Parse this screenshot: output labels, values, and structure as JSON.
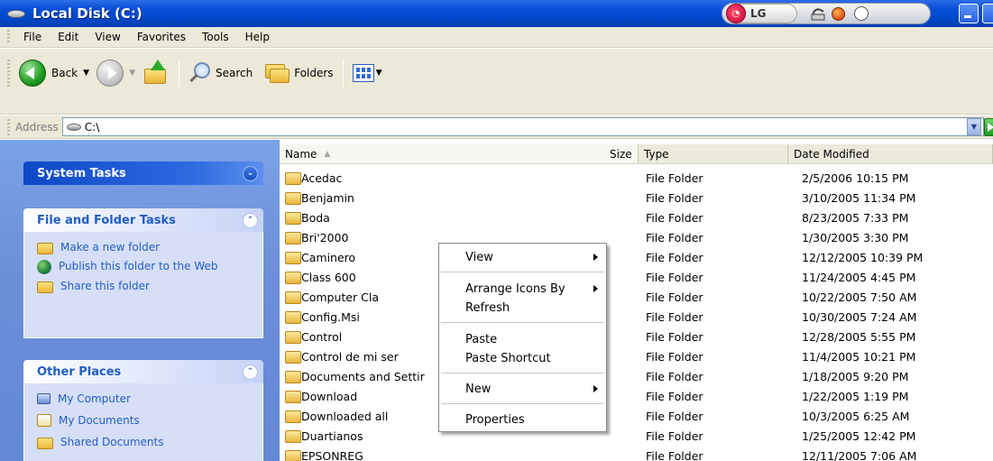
{
  "window": {
    "title": "Local Disk (C:)"
  },
  "tray": {
    "brand": "LG"
  },
  "menubar": {
    "items": [
      "File",
      "Edit",
      "View",
      "Favorites",
      "Tools",
      "Help"
    ]
  },
  "toolbar": {
    "back_label": "Back",
    "search_label": "Search",
    "folders_label": "Folders"
  },
  "address": {
    "label": "Address",
    "value": "C:\\"
  },
  "sidebar": {
    "system_tasks": {
      "title": "System Tasks"
    },
    "file_folder_tasks": {
      "title": "File and Folder Tasks",
      "items": [
        "Make a new folder",
        "Publish this folder to the Web",
        "Share this folder"
      ]
    },
    "other_places": {
      "title": "Other Places",
      "items": [
        "My Computer",
        "My Documents",
        "Shared Documents"
      ]
    }
  },
  "list": {
    "columns": {
      "name": "Name",
      "size": "Size",
      "type": "Type",
      "date": "Date Modified"
    },
    "rows": [
      {
        "name": "Acedac",
        "type": "File Folder",
        "date": "2/5/2006 10:15 PM"
      },
      {
        "name": "Benjamin",
        "type": "File Folder",
        "date": "3/10/2005 11:34 PM"
      },
      {
        "name": "Boda",
        "type": "File Folder",
        "date": "8/23/2005 7:33 PM"
      },
      {
        "name": "Bri'2000",
        "type": "File Folder",
        "date": "1/30/2005 3:30 PM"
      },
      {
        "name": "Caminero",
        "type": "File Folder",
        "date": "12/12/2005 10:39 PM"
      },
      {
        "name": "Class 600",
        "type": "File Folder",
        "date": "11/24/2005 4:45 PM"
      },
      {
        "name": "Computer Cla",
        "type": "File Folder",
        "date": "10/22/2005 7:50 AM"
      },
      {
        "name": "Config.Msi",
        "type": "File Folder",
        "date": "10/30/2005 7:24 AM"
      },
      {
        "name": "Control",
        "type": "File Folder",
        "date": "12/28/2005 5:55 PM"
      },
      {
        "name": "Control de mi ser",
        "type": "File Folder",
        "date": "11/4/2005 10:21 PM"
      },
      {
        "name": "Documents and Settir",
        "type": "File Folder",
        "date": "1/18/2005 9:20 PM"
      },
      {
        "name": "Download",
        "type": "File Folder",
        "date": "1/22/2005 1:19 PM"
      },
      {
        "name": "Downloaded all",
        "type": "File Folder",
        "date": "10/3/2005 6:25 AM"
      },
      {
        "name": "Duartianos",
        "type": "File Folder",
        "date": "1/25/2005 12:42 PM"
      },
      {
        "name": "EPSONREG",
        "type": "File Folder",
        "date": "12/11/2005 7:06 AM"
      }
    ]
  },
  "context_menu": {
    "view": "View",
    "arrange": "Arrange Icons By",
    "refresh": "Refresh",
    "paste": "Paste",
    "paste_shortcut": "Paste Shortcut",
    "new": "New",
    "properties": "Properties"
  }
}
